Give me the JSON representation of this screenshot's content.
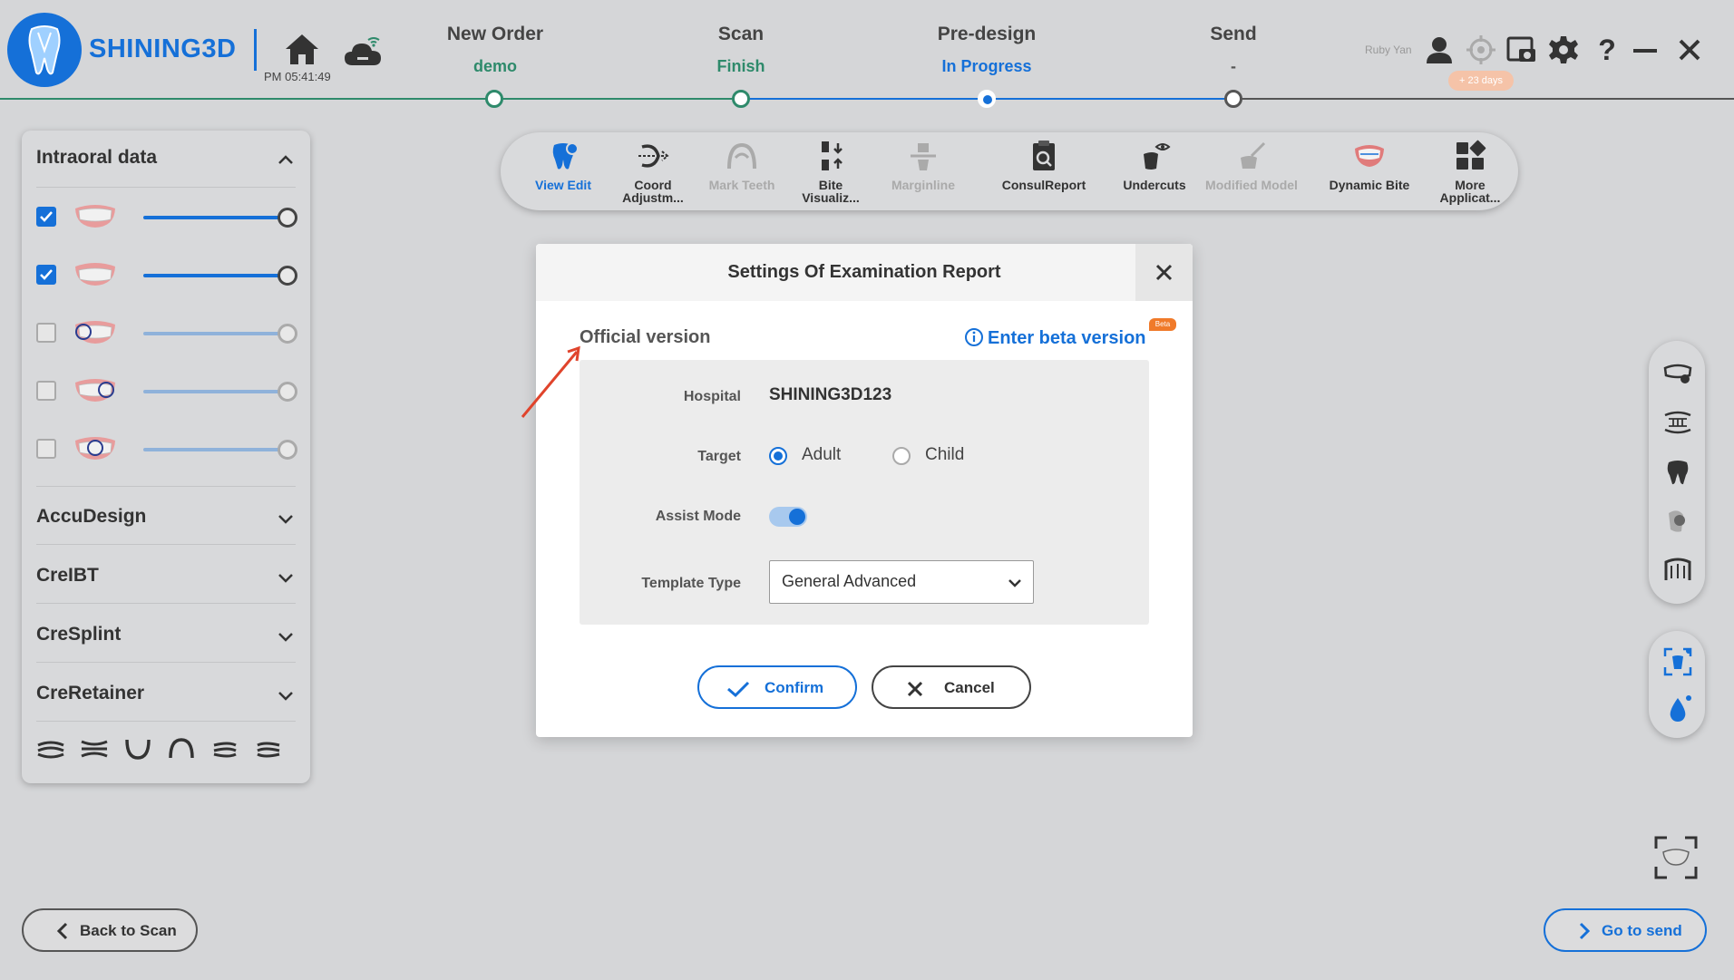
{
  "header": {
    "brand": "SHINING3D",
    "clock": "PM 05:41:49",
    "user_name": "Ruby Yan",
    "trial_badge": "+ 23 days",
    "steps": [
      {
        "title": "New Order",
        "status": "demo",
        "status_color": "#2e8a6b"
      },
      {
        "title": "Scan",
        "status": "Finish",
        "status_color": "#2e8a6b"
      },
      {
        "title": "Pre-design",
        "status": "In Progress",
        "status_color": "#1570d8"
      },
      {
        "title": "Send",
        "status": "-",
        "status_color": "#555555"
      }
    ],
    "icons": [
      "home-icon",
      "cloud-wifi-icon",
      "user-icon",
      "target-icon",
      "screenshot-icon",
      "gear-icon",
      "help-icon",
      "minimize-icon",
      "close-icon"
    ]
  },
  "left_panel": {
    "title": "Intraoral data",
    "layers": [
      {
        "checked": true,
        "level": 1.0
      },
      {
        "checked": true,
        "level": 1.0
      },
      {
        "checked": false,
        "level": 1.0
      },
      {
        "checked": false,
        "level": 1.0
      },
      {
        "checked": false,
        "level": 1.0
      }
    ],
    "sections": [
      "AccuDesign",
      "CreIBT",
      "CreSplint",
      "CreRetainer"
    ],
    "view_icons": [
      "view-front-icon",
      "view-back-icon",
      "view-lower-icon",
      "view-upper-icon",
      "view-left-icon",
      "view-right-icon"
    ]
  },
  "toolbar": {
    "tools": [
      {
        "label1": "View Edit",
        "label2": "",
        "state": "active",
        "icon": "view-edit-icon"
      },
      {
        "label1": "Coord",
        "label2": "Adjustm...",
        "state": "normal",
        "icon": "coord-adjust-icon"
      },
      {
        "label1": "Mark Teeth",
        "label2": "",
        "state": "disabled",
        "icon": "mark-teeth-icon"
      },
      {
        "label1": "Bite",
        "label2": "Visualiz...",
        "state": "normal",
        "icon": "bite-visualize-icon"
      },
      {
        "label1": "Marginline",
        "label2": "",
        "state": "disabled",
        "icon": "marginline-icon"
      },
      {
        "label1": "ConsulReport",
        "label2": "",
        "state": "normal",
        "icon": "consul-report-icon"
      },
      {
        "label1": "Undercuts",
        "label2": "",
        "state": "normal",
        "icon": "undercuts-icon"
      },
      {
        "label1": "Modified Model",
        "label2": "",
        "state": "disabled",
        "icon": "modified-model-icon"
      },
      {
        "label1": "Dynamic Bite",
        "label2": "",
        "state": "normal",
        "icon": "dynamic-bite-icon"
      },
      {
        "label1": "More",
        "label2": "Applicat...",
        "state": "normal",
        "icon": "more-apps-icon"
      }
    ]
  },
  "dialog": {
    "title": "Settings Of Examination Report",
    "version_label": "Official version",
    "beta_link": "Enter beta version",
    "beta_tag": "Beta",
    "hospital_label": "Hospital",
    "hospital_value": "SHINING3D123",
    "target_label": "Target",
    "target_options": [
      "Adult",
      "Child"
    ],
    "target_selected": "Adult",
    "assist_label": "Assist Mode",
    "assist_on": true,
    "template_label": "Template Type",
    "template_value": "General Advanced",
    "confirm_label": "Confirm",
    "cancel_label": "Cancel"
  },
  "footer": {
    "back_label": "Back to Scan",
    "send_label": "Go to send"
  },
  "colors": {
    "accent": "#1570d8",
    "done": "#2e8a6b",
    "arrow": "#e0442c"
  }
}
